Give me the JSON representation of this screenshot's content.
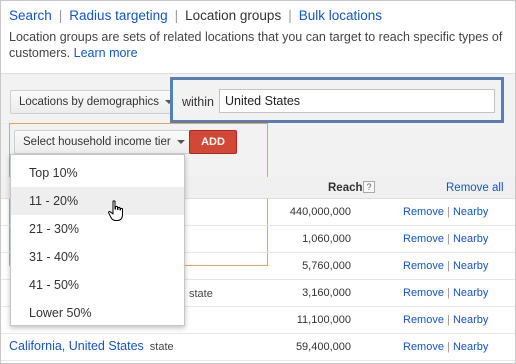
{
  "nav": {
    "tabs": [
      {
        "label": "Search",
        "active": false
      },
      {
        "label": "Radius targeting",
        "active": false
      },
      {
        "label": "Location groups",
        "active": true
      },
      {
        "label": "Bulk locations",
        "active": false
      }
    ],
    "separator": "|"
  },
  "description": {
    "text": "Location groups are sets of related locations that you can target to reach specific types of customers.",
    "learn_more": "Learn more"
  },
  "controls": {
    "group_type_label": "Locations by demographics",
    "within_label": "within",
    "within_value": "United States",
    "income_tier_label": "Select household income tier",
    "add_label": "ADD"
  },
  "dropdown": {
    "options": [
      "Top 10%",
      "11 - 20%",
      "21 - 30%",
      "31 - 40%",
      "41 - 50%",
      "Lower 50%"
    ],
    "hovered": "11 - 20%"
  },
  "table": {
    "reach_header": "Reach",
    "help_glyph": "?",
    "remove_all": "Remove all",
    "rows": [
      {
        "reach": "440,000,000",
        "remove": "Remove",
        "nearby": "Nearby"
      },
      {
        "reach": "1,060,000",
        "remove": "Remove",
        "nearby": "Nearby"
      },
      {
        "reach": "5,760,000",
        "remove": "Remove",
        "nearby": "Nearby"
      },
      {
        "reach": "3,160,000",
        "remove": "Remove",
        "nearby": "Nearby"
      },
      {
        "reach": "11,100,000",
        "remove": "Remove",
        "nearby": "Nearby"
      },
      {
        "reach": "59,400,000",
        "remove": "Remove",
        "nearby": "Nearby",
        "location": "California, United States",
        "type": "state"
      }
    ],
    "action_separator": "|",
    "partial_row_fragment": "state"
  },
  "colors": {
    "link": "#1155cc",
    "add_button": "#d14836",
    "within_highlight": "#5b7db1",
    "income_highlight": "#e8a35b"
  },
  "icons": {
    "caret": "caret-down-icon",
    "help": "help-icon",
    "cursor": "hand-pointer-cursor"
  }
}
